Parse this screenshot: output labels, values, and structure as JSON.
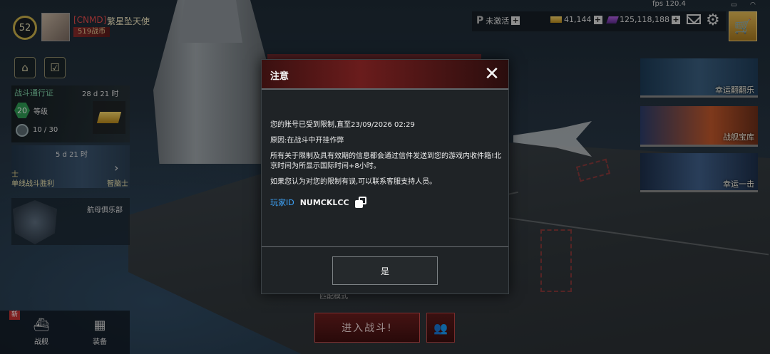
{
  "status": {
    "fps": "fps 120.4"
  },
  "player": {
    "level": "52",
    "clan_tag": "[CNMD]",
    "name": "繁星坠天使",
    "points_badge": "519战币"
  },
  "topbar": {
    "rank_label": "未激活",
    "gold": "41,144",
    "gems": "125,118,188"
  },
  "battle_pass": {
    "title": "战斗通行证",
    "time_left": "28 d 21 时",
    "level": "20",
    "level_label": "等级",
    "progress": "10 / 30"
  },
  "event": {
    "time_left": "5 d 21 时",
    "side_label": "士",
    "label_left": "单线战斗胜利",
    "label_right": "智脑士"
  },
  "club": {
    "label": "航母俱乐部"
  },
  "bottom_nav": {
    "new_badge": "新",
    "ships": "战舰",
    "equipment": "装备"
  },
  "right_panels": {
    "flip": "幸运翻翻乐",
    "warehouse": "战舰宝库",
    "lucky_strike": "幸运一击"
  },
  "battle": {
    "mode": "匹配模式",
    "enter_label": "进入战斗!"
  },
  "dialog": {
    "title": "注意",
    "line1": "您的账号已受到限制,直至23/09/2026 02:29",
    "line2": "原因:在战斗中开挂作弊",
    "line3": "所有关于限制及具有效期的信息都会通过信件发送到您的游戏内收件箱!北京时间为所显示国际时间+8小时。",
    "line4": "如果您认为对您的限制有误,可以联系客服支持人员。",
    "player_id_label": "玩家ID",
    "player_id_value": "NUMCKLCC",
    "ok_label": "是"
  },
  "colors": {
    "accent_red": "#6a1c1c",
    "link_blue": "#3fa7ff",
    "gold": "#e2b955"
  },
  "icons": [
    "close-icon",
    "copy-icon",
    "gear-icon",
    "mail-icon",
    "shop-cart-icon",
    "gold-bar-icon",
    "gem-icon"
  ]
}
